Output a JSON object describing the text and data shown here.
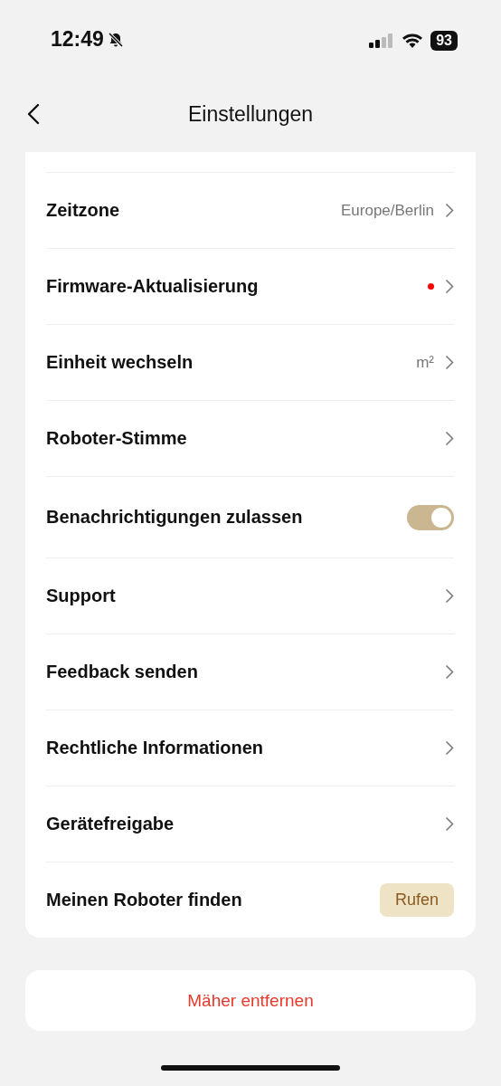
{
  "status_bar": {
    "time": "12:49",
    "battery": "93"
  },
  "header": {
    "title": "Einstellungen"
  },
  "settings": [
    {
      "kind": "nav",
      "label": "Zeitzone",
      "value": "Europe/Berlin",
      "dot": false
    },
    {
      "kind": "nav",
      "label": "Firmware-Aktualisierung",
      "dot": true
    },
    {
      "kind": "nav",
      "label": "Einheit wechseln",
      "value": "m²",
      "dot": false
    },
    {
      "kind": "nav",
      "label": "Roboter-Stimme",
      "dot": false
    },
    {
      "kind": "toggle",
      "label": "Benachrichtigungen zulassen",
      "on": true
    },
    {
      "kind": "nav",
      "label": "Support",
      "dot": false
    },
    {
      "kind": "nav",
      "label": "Feedback senden",
      "dot": false
    },
    {
      "kind": "nav",
      "label": "Rechtliche Informationen",
      "dot": false
    },
    {
      "kind": "nav",
      "label": "Gerätefreigabe",
      "dot": false
    },
    {
      "kind": "button",
      "label": "Meinen Roboter finden",
      "button_label": "Rufen"
    }
  ],
  "remove_button": "Mäher entfernen"
}
